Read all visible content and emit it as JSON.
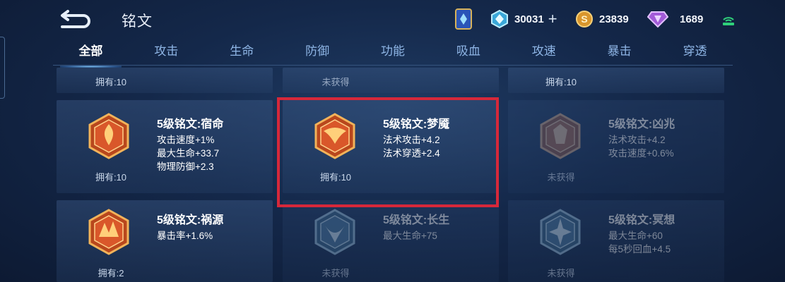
{
  "header": {
    "title": "铭文",
    "currencies": [
      {
        "name": "diamond-coupon",
        "value": "30031",
        "has_plus": true,
        "color": "#7fd8f0"
      },
      {
        "name": "gold-coin",
        "value": "23839",
        "has_plus": false,
        "color": "#e0a040"
      },
      {
        "name": "gem",
        "value": "1689",
        "has_plus": false,
        "color": "#b070e0"
      }
    ],
    "plus_label": "+"
  },
  "tabs": [
    "全部",
    "攻击",
    "生命",
    "防御",
    "功能",
    "吸血",
    "攻速",
    "暴击",
    "穿透"
  ],
  "active_tab": 0,
  "top_row_owned": [
    "拥有:10",
    "未获得",
    "拥有:10"
  ],
  "cards": [
    {
      "name": "5级铭文:宿命",
      "stats": [
        "攻击速度+1%",
        "最大生命+33.7",
        "物理防御+2.3"
      ],
      "owned": "拥有:10",
      "faded": false,
      "color": "red"
    },
    {
      "name": "5级铭文:梦魇",
      "stats": [
        "法术攻击+4.2",
        "法术穿透+2.4"
      ],
      "owned": "拥有:10",
      "faded": false,
      "color": "red",
      "highlighted": true
    },
    {
      "name": "5级铭文:凶兆",
      "stats": [
        "法术攻击+4.2",
        "攻击速度+0.6%"
      ],
      "owned": "未获得",
      "faded": true,
      "color": "red"
    },
    {
      "name": "5级铭文:祸源",
      "stats": [
        "暴击率+1.6%"
      ],
      "owned": "拥有:2",
      "faded": false,
      "color": "red"
    },
    {
      "name": "5级铭文:长生",
      "stats": [
        "最大生命+75"
      ],
      "owned": "未获得",
      "faded": true,
      "color": "blue"
    },
    {
      "name": "5级铭文:冥想",
      "stats": [
        "最大生命+60",
        "每5秒回血+4.5"
      ],
      "owned": "未获得",
      "faded": true,
      "color": "blue"
    }
  ]
}
